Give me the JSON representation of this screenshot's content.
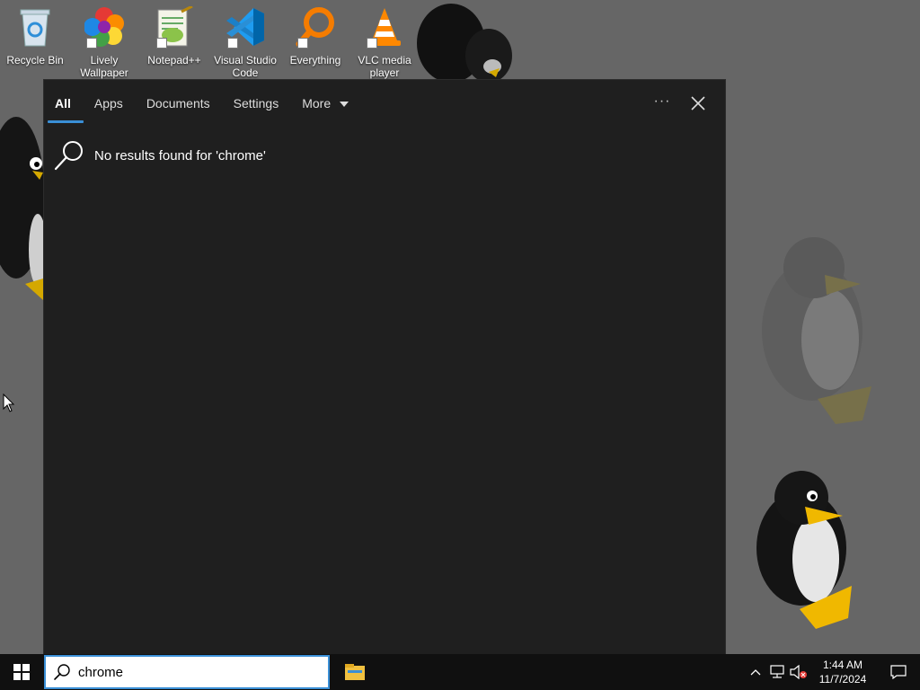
{
  "desktop": {
    "background_color": "#666666",
    "icons": [
      {
        "label": "Recycle Bin",
        "icon": "recycle-bin-icon"
      },
      {
        "label": "Lively Wallpaper",
        "icon": "lively-wallpaper-icon"
      },
      {
        "label": "Notepad++",
        "icon": "notepad-plus-plus-icon"
      },
      {
        "label": "Visual Studio Code",
        "icon": "vscode-icon"
      },
      {
        "label": "Everything",
        "icon": "everything-search-icon"
      },
      {
        "label": "VLC media player",
        "icon": "vlc-icon"
      }
    ]
  },
  "search_panel": {
    "background_color": "#1f1f1f",
    "accent_color": "#3a8fd6",
    "tabs": [
      {
        "label": "All",
        "active": true
      },
      {
        "label": "Apps",
        "active": false
      },
      {
        "label": "Documents",
        "active": false
      },
      {
        "label": "Settings",
        "active": false
      },
      {
        "label": "More",
        "active": false
      }
    ],
    "ellipsis": "···",
    "no_results_text": "No results found for 'chrome'"
  },
  "taskbar": {
    "search": {
      "value": "chrome"
    },
    "clock": {
      "time": "1:44 AM",
      "date": "11/7/2024"
    }
  }
}
